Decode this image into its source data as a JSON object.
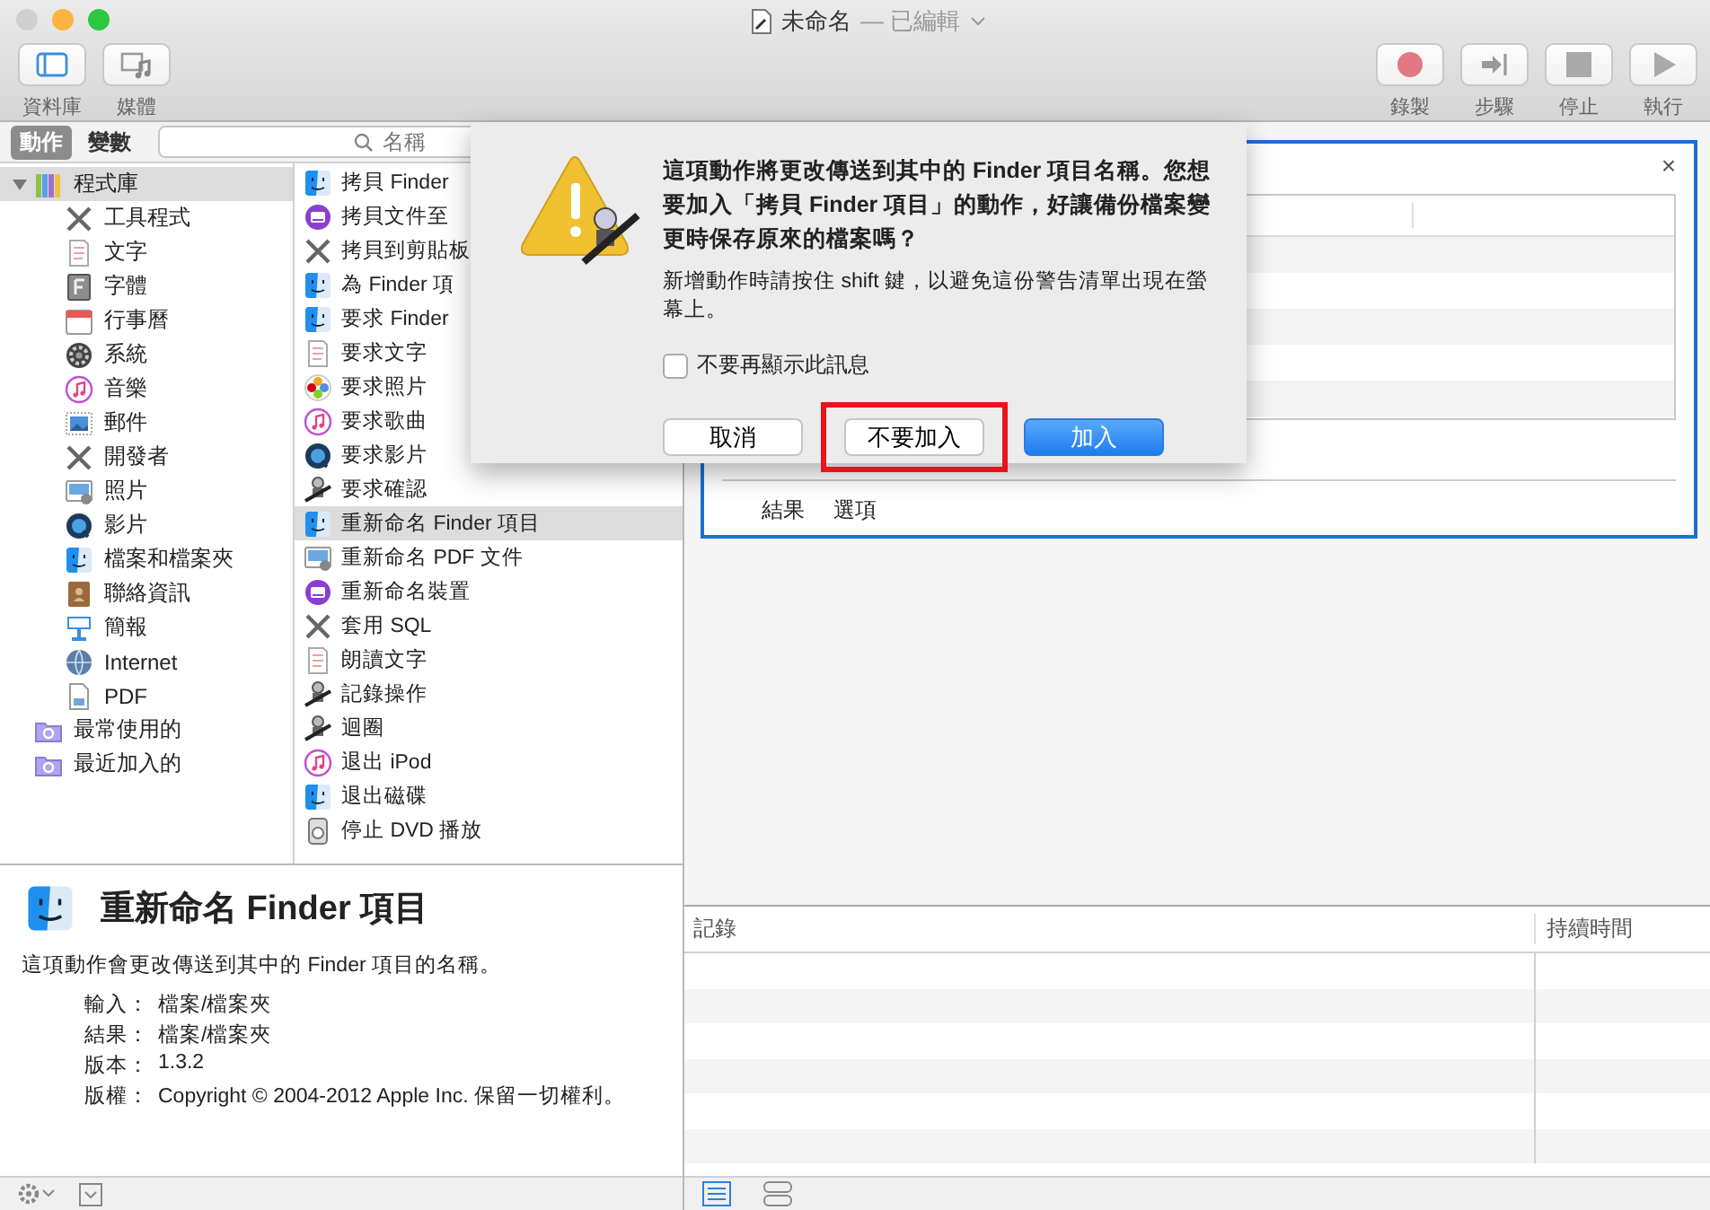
{
  "window": {
    "title": "未命名",
    "status": "— 已編輯"
  },
  "toolbar": {
    "left": [
      {
        "label": "資料庫",
        "kind": "library"
      },
      {
        "label": "媒體",
        "kind": "media"
      }
    ],
    "right": [
      {
        "label": "錄製",
        "kind": "record"
      },
      {
        "label": "步驟",
        "kind": "step"
      },
      {
        "label": "停止",
        "kind": "stop"
      },
      {
        "label": "執行",
        "kind": "run"
      }
    ]
  },
  "tabs": [
    {
      "label": "動作",
      "selected": true
    },
    {
      "label": "變數",
      "selected": false
    }
  ],
  "search": {
    "placeholder": "名稱"
  },
  "library": [
    {
      "label": "程式庫",
      "kind": "books",
      "expanded": true,
      "selected": true,
      "children": [
        {
          "label": "工具程式",
          "kind": "tools",
          "selected": false
        },
        {
          "label": "文字",
          "kind": "doc",
          "selected": false
        },
        {
          "label": "字體",
          "kind": "font",
          "selected": false
        },
        {
          "label": "行事曆",
          "kind": "calendar",
          "selected": false
        },
        {
          "label": "系統",
          "kind": "gear",
          "selected": false
        },
        {
          "label": "音樂",
          "kind": "music",
          "selected": false
        },
        {
          "label": "郵件",
          "kind": "mail",
          "selected": false
        },
        {
          "label": "開發者",
          "kind": "tools",
          "selected": false
        },
        {
          "label": "照片",
          "kind": "photo",
          "selected": false
        },
        {
          "label": "影片",
          "kind": "movie",
          "selected": false
        },
        {
          "label": "檔案和檔案夾",
          "kind": "finder",
          "selected": false
        },
        {
          "label": "聯絡資訊",
          "kind": "contacts",
          "selected": false
        },
        {
          "label": "簡報",
          "kind": "keynote",
          "selected": false
        },
        {
          "label": "Internet",
          "kind": "globe",
          "selected": false
        },
        {
          "label": "PDF",
          "kind": "pdf",
          "selected": false
        }
      ]
    },
    {
      "label": "最常使用的",
      "kind": "folder",
      "selected": false
    },
    {
      "label": "最近加入的",
      "kind": "folder",
      "selected": false
    }
  ],
  "actions": [
    {
      "label": "拷貝 Finder",
      "kind": "finder",
      "selected": false
    },
    {
      "label": "拷貝文件至",
      "kind": "device",
      "selected": false
    },
    {
      "label": "拷貝到剪貼板",
      "kind": "tools",
      "selected": false
    },
    {
      "label": "為 Finder 項",
      "kind": "finder",
      "selected": false
    },
    {
      "label": "要求 Finder",
      "kind": "finder",
      "selected": false
    },
    {
      "label": "要求文字",
      "kind": "doc",
      "selected": false
    },
    {
      "label": "要求照片",
      "kind": "flower",
      "selected": false
    },
    {
      "label": "要求歌曲",
      "kind": "music",
      "selected": false
    },
    {
      "label": "要求影片",
      "kind": "movie",
      "selected": false
    },
    {
      "label": "要求確認",
      "kind": "robot",
      "selected": false
    },
    {
      "label": "重新命名 Finder 項目",
      "kind": "finder",
      "selected": true
    },
    {
      "label": "重新命名 PDF 文件",
      "kind": "photo",
      "selected": false
    },
    {
      "label": "重新命名裝置",
      "kind": "device",
      "selected": false
    },
    {
      "label": "套用 SQL",
      "kind": "tools",
      "selected": false
    },
    {
      "label": "朗讀文字",
      "kind": "doc",
      "selected": false
    },
    {
      "label": "記錄操作",
      "kind": "robot",
      "selected": false
    },
    {
      "label": "迴圈",
      "kind": "robot",
      "selected": false
    },
    {
      "label": "退出 iPod",
      "kind": "music",
      "selected": false
    },
    {
      "label": "退出磁碟",
      "kind": "finder",
      "selected": false
    },
    {
      "label": "停止 DVD 播放",
      "kind": "dvd",
      "selected": false
    }
  ],
  "description": {
    "title": "重新命名 Finder 項目",
    "text": "這項動作會更改傳送到其中的 Finder 項目的名稱。",
    "properties": [
      {
        "label": "輸入：",
        "value": "檔案/檔案夾"
      },
      {
        "label": "結果：",
        "value": "檔案/檔案夾"
      },
      {
        "label": "版本：",
        "value": "1.3.2"
      },
      {
        "label": "版權：",
        "value": "Copyright © 2004-2012 Apple Inc. 保留一切權利。"
      }
    ]
  },
  "workflow_card": {
    "close": "×",
    "tabs": [
      "結果",
      "選項"
    ]
  },
  "log": {
    "columns": [
      "記錄",
      "持續時間"
    ]
  },
  "view_buttons": [
    {
      "kind": "list",
      "selected": true
    },
    {
      "kind": "split",
      "selected": false
    }
  ],
  "dialog": {
    "message": "這項動作將更改傳送到其中的 Finder 項目名稱。您想要加入「拷貝 Finder 項目」的動作，好讓備份檔案變更時保存原來的檔案嗎？",
    "note": "新增動作時請按住 shift 鍵，以避免這份警告清單出現在螢幕上。",
    "checkbox": {
      "label": "不要再顯示此訊息",
      "checked": false
    },
    "buttons": [
      {
        "label": "取消",
        "kind": "normal",
        "highlighted": false
      },
      {
        "label": "不要加入",
        "kind": "normal",
        "highlighted": true
      },
      {
        "label": "加入",
        "kind": "default",
        "highlighted": false
      }
    ]
  }
}
